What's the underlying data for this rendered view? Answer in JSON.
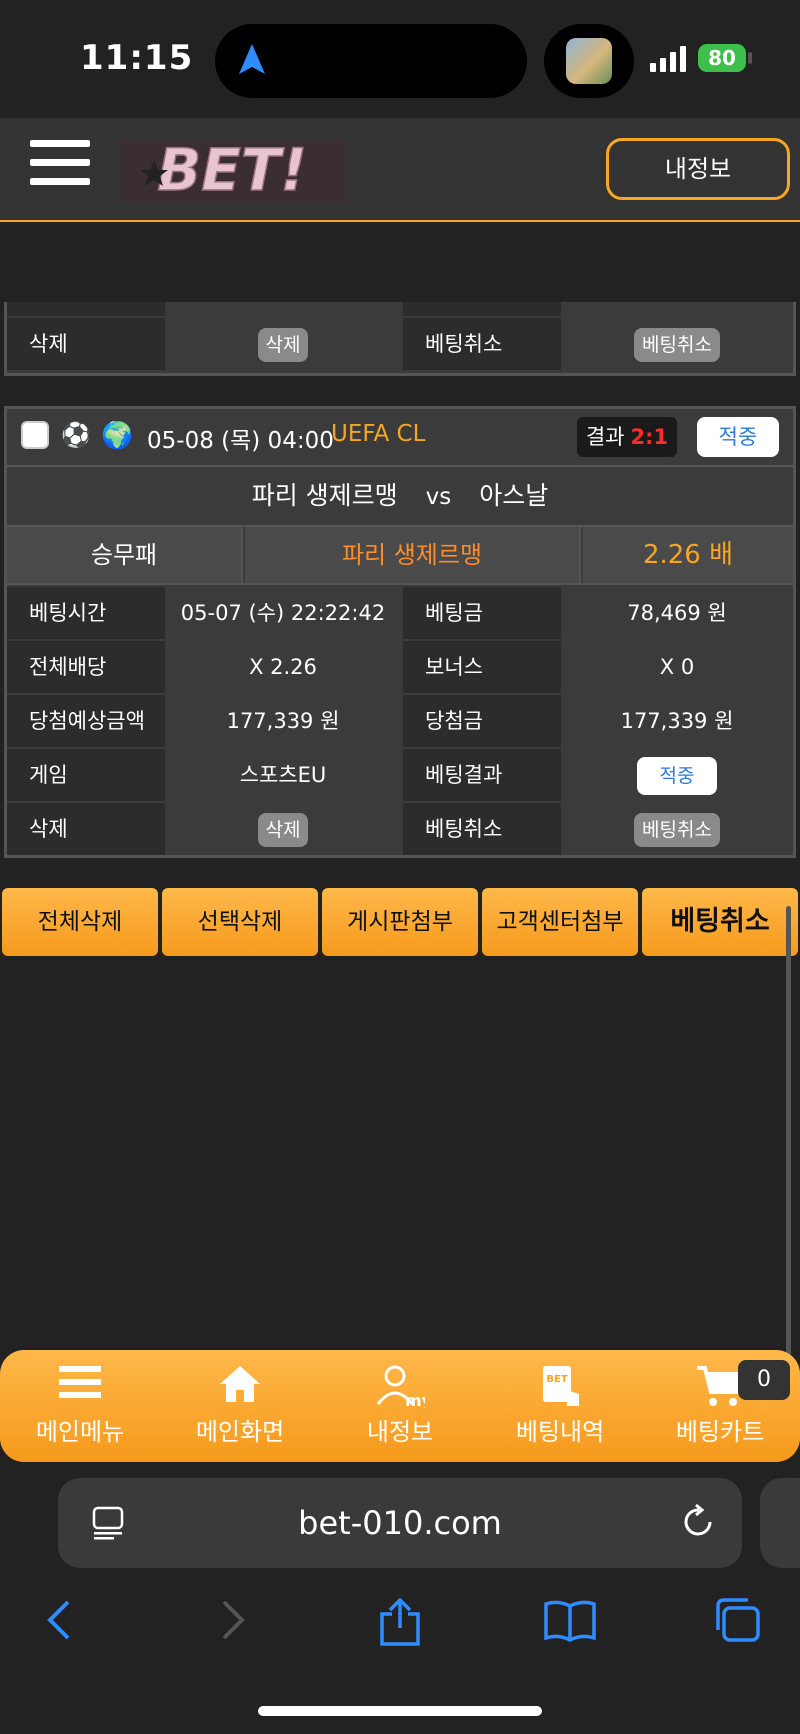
{
  "status": {
    "time": "11:15",
    "battery": "80"
  },
  "header": {
    "logo_text": "BET!",
    "myinfo_label": "내정보"
  },
  "prev_card": {
    "delete_label": "삭제",
    "delete_btn": "삭제",
    "cancel_label": "베팅취소",
    "cancel_btn": "베팅취소"
  },
  "card": {
    "date": "05-08 (목) 04:00",
    "league": "UEFA CL",
    "result_label": "결과",
    "result_score": "2:1",
    "status_badge": "적중",
    "home_team": "파리 생제르맹",
    "vs": "vs",
    "away_team": "아스날",
    "pick_type": "승무패",
    "pick_team": "파리 생제르맹",
    "pick_odds": "2.26 배",
    "rows": [
      {
        "l1": "베팅시간",
        "v1": "05-07 (수) 22:22:42",
        "l2": "베팅금",
        "v2": "78,469 원"
      },
      {
        "l1": "전체배당",
        "v1": "X 2.26",
        "l2": "보너스",
        "v2": "X 0"
      },
      {
        "l1": "당첨예상금액",
        "v1": "177,339 원",
        "l2": "당첨금",
        "v2": "177,339 원"
      },
      {
        "l1": "게임",
        "v1": "스포츠EU",
        "l2": "베팅결과",
        "v2": "적중"
      },
      {
        "l1": "삭제",
        "v1": "삭제",
        "l2": "베팅취소",
        "v2": "베팅취소"
      }
    ]
  },
  "actions": [
    "전체삭제",
    "선택삭제",
    "게시판첨부",
    "고객센터첨부",
    "베팅취소"
  ],
  "bottom_nav": {
    "items": [
      {
        "label": "메인메뉴",
        "icon": "menu-icon"
      },
      {
        "label": "메인화면",
        "icon": "home-icon"
      },
      {
        "label": "내정보",
        "icon": "my-icon"
      },
      {
        "label": "베팅내역",
        "icon": "bet-history-icon"
      },
      {
        "label": "베팅카트",
        "icon": "cart-icon"
      }
    ],
    "cart_count": "0"
  },
  "browser": {
    "url": "bet-010.com"
  },
  "colors": {
    "accent": "#f5a623",
    "win": "#2d7bd8",
    "score": "#ff2a2a",
    "pick": "#ff8c2a"
  }
}
